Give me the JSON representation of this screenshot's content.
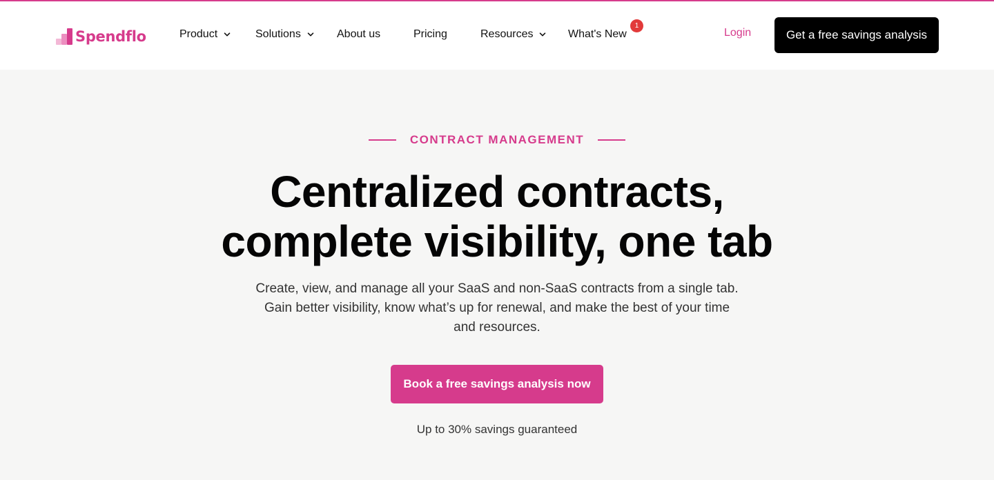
{
  "brand": {
    "name": "Spendflo",
    "color": "#d63b8c"
  },
  "nav": {
    "items": [
      {
        "label": "Product",
        "has_dropdown": true
      },
      {
        "label": "Solutions",
        "has_dropdown": true
      },
      {
        "label": "About us",
        "has_dropdown": false
      },
      {
        "label": "Pricing",
        "has_dropdown": false
      },
      {
        "label": "Resources",
        "has_dropdown": true
      },
      {
        "label": "What's New",
        "has_dropdown": false
      }
    ],
    "whats_new_badge": "1",
    "login_label": "Login",
    "cta_label": "Get a free savings analysis"
  },
  "hero": {
    "eyebrow": "CONTRACT MANAGEMENT",
    "title_line1": "Centralized contracts,",
    "title_line2": "complete visibility, one tab",
    "subtitle": "Create, view, and manage all your SaaS and non-SaaS contracts from a single tab. Gain better visibility, know what’s up for renewal, and make the best of your time and resources.",
    "cta_label": "Book a free savings analysis now",
    "guarantee": "Up to 30% savings guaranteed"
  },
  "colors": {
    "accent": "#d63b8c",
    "dark_button": "#000000",
    "badge": "#e23a3a",
    "background": "#f6f6f5"
  }
}
